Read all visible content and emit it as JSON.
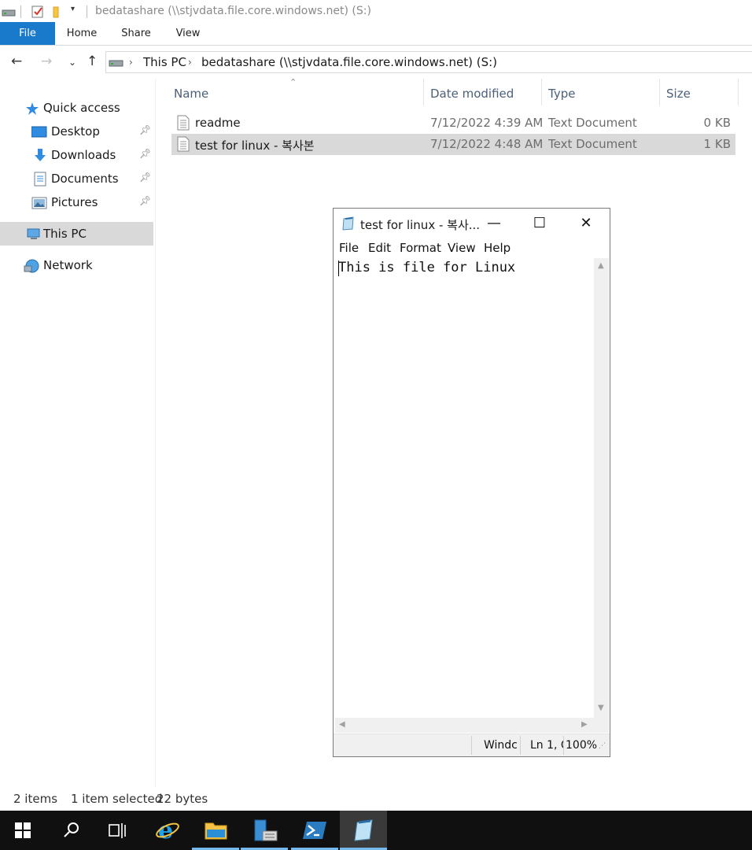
{
  "explorer": {
    "window_title": "bedatashare (\\\\stjvdata.file.core.windows.net) (S:)",
    "ribbon_tabs": [
      "File",
      "Home",
      "Share",
      "View"
    ],
    "breadcrumb": [
      "This PC",
      "bedatashare (\\\\stjvdata.file.core.windows.net) (S:)"
    ],
    "sidebar": [
      {
        "label": "Quick access",
        "icon": "star-icon",
        "pinned": false
      },
      {
        "label": "Desktop",
        "icon": "desktop-icon",
        "pinned": true
      },
      {
        "label": "Downloads",
        "icon": "downloads-icon",
        "pinned": true
      },
      {
        "label": "Documents",
        "icon": "documents-icon",
        "pinned": true
      },
      {
        "label": "Pictures",
        "icon": "pictures-icon",
        "pinned": true
      },
      {
        "label": "This PC",
        "icon": "computer-icon",
        "pinned": false,
        "selected": true
      },
      {
        "label": "Network",
        "icon": "network-icon",
        "pinned": false
      }
    ],
    "columns": [
      "Name",
      "Date modified",
      "Type",
      "Size"
    ],
    "files": [
      {
        "name": "readme",
        "date": "7/12/2022 4:39 AM",
        "type": "Text Document",
        "size": "0 KB",
        "selected": false
      },
      {
        "name": "test for linux - 복사본",
        "date": "7/12/2022 4:48 AM",
        "type": "Text Document",
        "size": "1 KB",
        "selected": true
      }
    ],
    "status": {
      "items": "2 items",
      "selected": "1 item selected",
      "bytes": "22 bytes"
    }
  },
  "notepad": {
    "title": "test for linux - 복사...",
    "menu": [
      "File",
      "Edit",
      "Format",
      "View",
      "Help"
    ],
    "content": "This is file for Linux",
    "status": {
      "eol": "Windc",
      "position": "Ln 1, C",
      "zoom": "100%"
    }
  },
  "taskbar": {
    "items": [
      "start-icon",
      "search-icon",
      "task-view-icon",
      "internet-explorer-icon",
      "file-explorer-icon",
      "server-manager-icon",
      "powershell-icon",
      "notepad-icon"
    ]
  },
  "colors": {
    "accent": "#1979ca",
    "selection": "#d9d9d9",
    "taskbar": "#101010",
    "header_text": "#4c607a"
  }
}
